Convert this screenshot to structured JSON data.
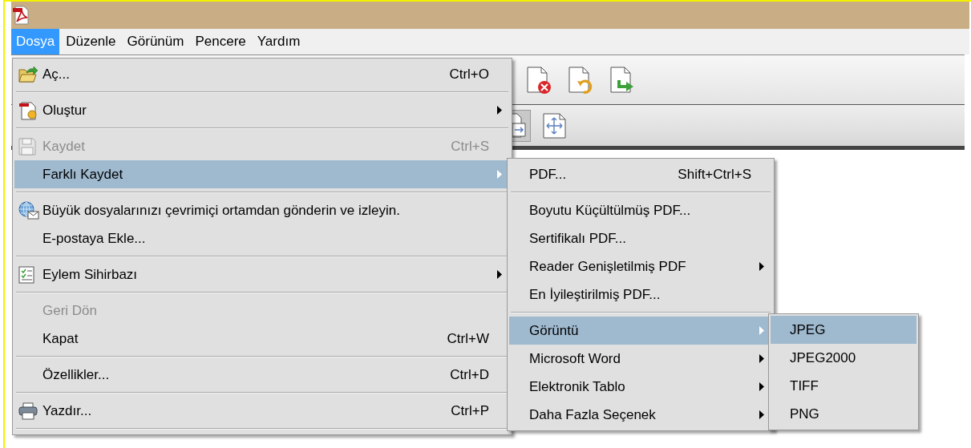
{
  "menu_bar": [
    {
      "label": "Dosya",
      "selected": true
    },
    {
      "label": "Düzenle",
      "selected": false
    },
    {
      "label": "Görünüm",
      "selected": false
    },
    {
      "label": "Pencere",
      "selected": false
    },
    {
      "label": "Yardım",
      "selected": false
    }
  ],
  "file_menu": {
    "items": [
      {
        "kind": "item",
        "label": "Aç...",
        "shortcut": "Ctrl+O",
        "disabled": false,
        "selected": false,
        "has_submenu": false
      },
      {
        "kind": "separator"
      },
      {
        "kind": "item",
        "label": "Oluştur",
        "disabled": false,
        "selected": false,
        "has_submenu": true
      },
      {
        "kind": "separator"
      },
      {
        "kind": "item",
        "label": "Kaydet",
        "shortcut": "Ctrl+S",
        "disabled": true,
        "selected": false,
        "has_submenu": false
      },
      {
        "kind": "item",
        "label": "Farklı Kaydet",
        "disabled": false,
        "selected": true,
        "has_submenu": true
      },
      {
        "kind": "separator"
      },
      {
        "kind": "item",
        "label": "Büyük dosyalarınızı çevrimiçi ortamdan gönderin ve izleyin.",
        "disabled": false,
        "selected": false,
        "has_submenu": false
      },
      {
        "kind": "item",
        "label": "E-postaya Ekle...",
        "disabled": false,
        "selected": false,
        "has_submenu": false
      },
      {
        "kind": "separator"
      },
      {
        "kind": "item",
        "label": "Eylem Sihirbazı",
        "disabled": false,
        "selected": false,
        "has_submenu": true
      },
      {
        "kind": "separator"
      },
      {
        "kind": "item",
        "label": "Geri Dön",
        "disabled": true,
        "selected": false,
        "has_submenu": false
      },
      {
        "kind": "item",
        "label": "Kapat",
        "shortcut": "Ctrl+W",
        "disabled": false,
        "selected": false,
        "has_submenu": false
      },
      {
        "kind": "separator"
      },
      {
        "kind": "item",
        "label": "Özellikler...",
        "shortcut": "Ctrl+D",
        "disabled": false,
        "selected": false,
        "has_submenu": false
      },
      {
        "kind": "separator"
      },
      {
        "kind": "item",
        "label": "Yazdır...",
        "shortcut": "Ctrl+P",
        "disabled": false,
        "selected": false,
        "has_submenu": false
      },
      {
        "kind": "separator"
      }
    ]
  },
  "save_as_submenu": {
    "items": [
      {
        "kind": "item",
        "label": "PDF...",
        "shortcut": "Shift+Ctrl+S",
        "disabled": false,
        "selected": false,
        "has_submenu": false
      },
      {
        "kind": "separator"
      },
      {
        "kind": "item",
        "label": "Boyutu Küçültülmüş PDF...",
        "disabled": false,
        "selected": false,
        "has_submenu": false
      },
      {
        "kind": "item",
        "label": "Sertifikalı PDF...",
        "disabled": false,
        "selected": false,
        "has_submenu": false
      },
      {
        "kind": "item",
        "label": "Reader Genişletilmiş PDF",
        "disabled": false,
        "selected": false,
        "has_submenu": true
      },
      {
        "kind": "item",
        "label": "En İyileştirilmiş PDF...",
        "disabled": false,
        "selected": false,
        "has_submenu": false
      },
      {
        "kind": "separator"
      },
      {
        "kind": "item",
        "label": "Görüntü",
        "disabled": false,
        "selected": true,
        "has_submenu": true
      },
      {
        "kind": "item",
        "label": "Microsoft Word",
        "disabled": false,
        "selected": false,
        "has_submenu": true
      },
      {
        "kind": "item",
        "label": "Elektronik Tablo",
        "disabled": false,
        "selected": false,
        "has_submenu": true
      },
      {
        "kind": "item",
        "label": "Daha Fazla Seçenek",
        "disabled": false,
        "selected": false,
        "has_submenu": true
      }
    ]
  },
  "image_submenu": {
    "items": [
      {
        "kind": "item",
        "label": "JPEG",
        "disabled": false,
        "selected": true,
        "has_submenu": false
      },
      {
        "kind": "item",
        "label": "JPEG2000",
        "disabled": false,
        "selected": false,
        "has_submenu": false
      },
      {
        "kind": "item",
        "label": "TIFF",
        "disabled": false,
        "selected": false,
        "has_submenu": false
      },
      {
        "kind": "item",
        "label": "PNG",
        "disabled": false,
        "selected": false,
        "has_submenu": false
      }
    ]
  }
}
